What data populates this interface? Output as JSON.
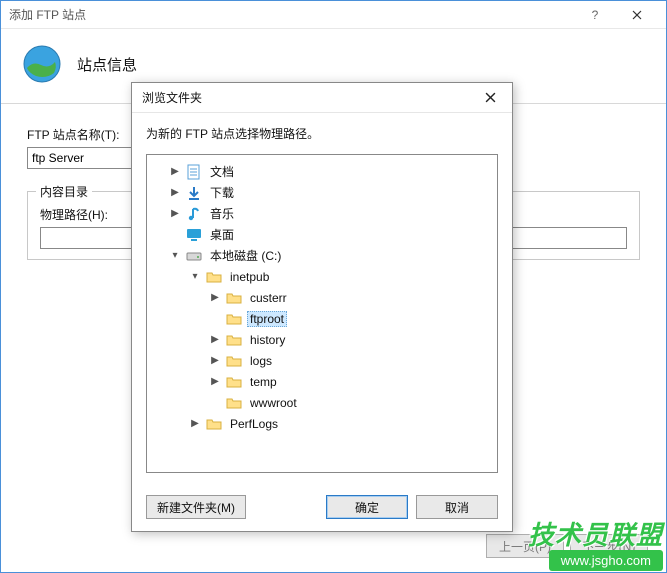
{
  "mainWindow": {
    "title": "添加 FTP 站点",
    "wizardTitle": "站点信息",
    "siteNameLabel": "FTP 站点名称(T):",
    "siteNameValue": "ftp Server",
    "contentDirLegend": "内容目录",
    "physicalPathLabel": "物理路径(H):",
    "physicalPathValue": "",
    "buttons": {
      "prev": "上一页(P)",
      "next": "下一步(N)"
    }
  },
  "browseDialog": {
    "title": "浏览文件夹",
    "prompt": "为新的 FTP 站点选择物理路径。",
    "buttons": {
      "newFolder": "新建文件夹(M)",
      "ok": "确定",
      "cancel": "取消"
    },
    "tree": {
      "documents": "文档",
      "downloads": "下载",
      "music": "音乐",
      "desktop": "桌面",
      "localDisk": "本地磁盘 (C:)",
      "inetpub": "inetpub",
      "custerr": "custerr",
      "ftproot": "ftproot",
      "history": "history",
      "logs": "logs",
      "temp": "temp",
      "wwwroot": "wwwroot",
      "perflogs": "PerfLogs"
    }
  },
  "watermark": {
    "text": "技术员联盟",
    "url": "www.jsgho.com"
  }
}
